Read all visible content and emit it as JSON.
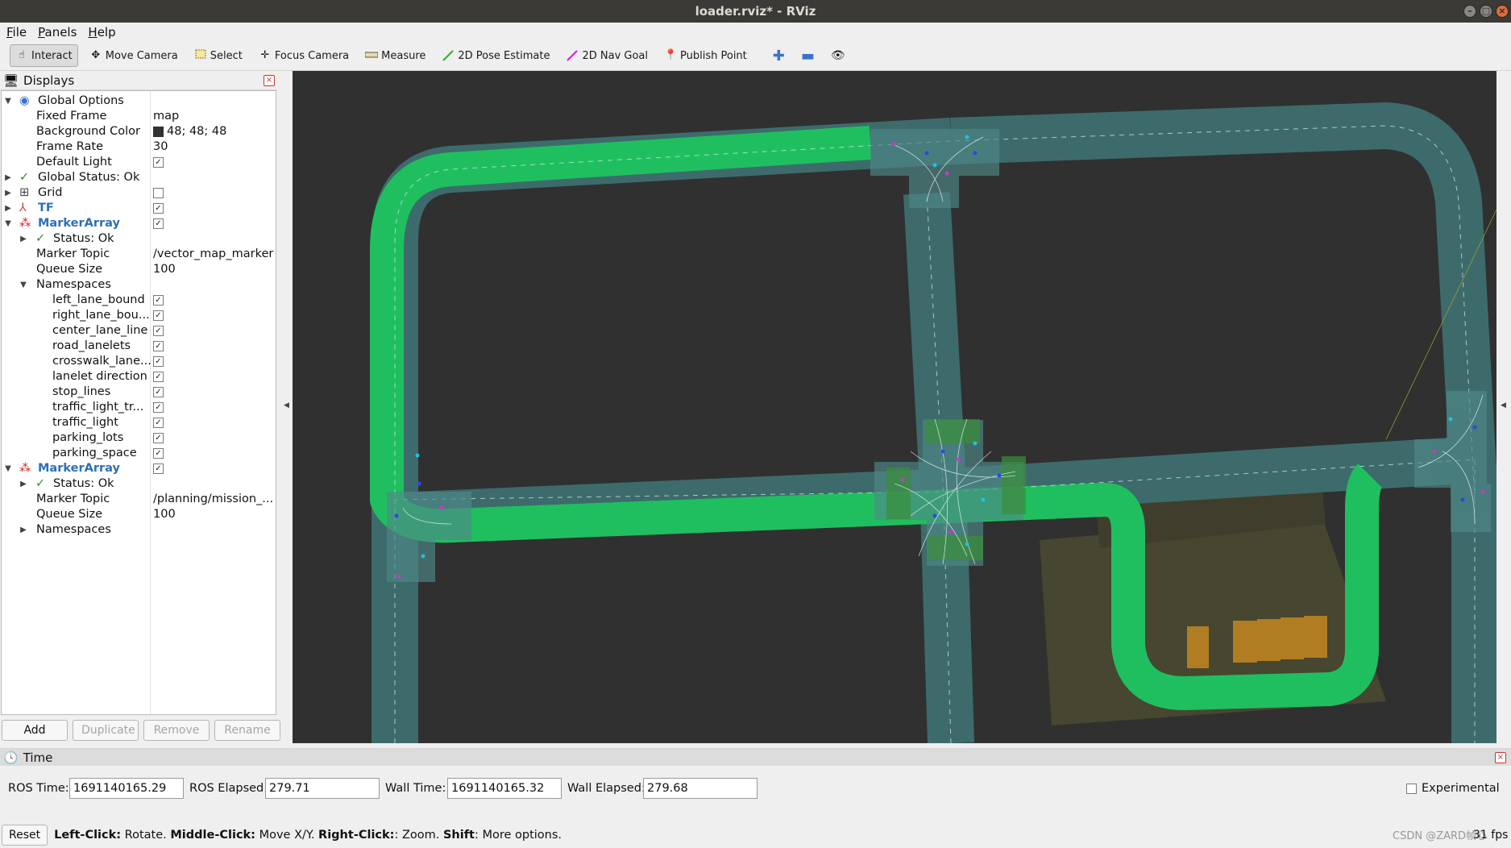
{
  "window": {
    "title": "loader.rviz* - RViz"
  },
  "menu": [
    "File",
    "Panels",
    "Help"
  ],
  "toolbar": {
    "tools": [
      {
        "label": "Interact",
        "icon": "hand-icon"
      },
      {
        "label": "Move Camera",
        "icon": "move-camera-icon"
      },
      {
        "label": "Select",
        "icon": "select-icon"
      },
      {
        "label": "Focus Camera",
        "icon": "focus-camera-icon"
      },
      {
        "label": "Measure",
        "icon": "ruler-icon"
      },
      {
        "label": "2D Pose Estimate",
        "icon": "green-arrow-icon"
      },
      {
        "label": "2D Nav Goal",
        "icon": "magenta-arrow-icon"
      },
      {
        "label": "Publish Point",
        "icon": "map-pin-icon"
      }
    ]
  },
  "displays": {
    "title": "Displays",
    "rows": [
      {
        "label": "Global Options",
        "value": ""
      },
      {
        "label": "Fixed Frame",
        "value": "map"
      },
      {
        "label": "Background Color",
        "value": "48; 48; 48"
      },
      {
        "label": "Frame Rate",
        "value": "30"
      },
      {
        "label": "Default Light",
        "value": ""
      },
      {
        "label": "Global Status: Ok",
        "value": ""
      },
      {
        "label": "Grid",
        "value": ""
      },
      {
        "label": "TF",
        "value": ""
      },
      {
        "label": "MarkerArray",
        "value": ""
      },
      {
        "label": "Status: Ok",
        "value": ""
      },
      {
        "label": "Marker Topic",
        "value": "/vector_map_marker"
      },
      {
        "label": "Queue Size",
        "value": "100"
      },
      {
        "label": "Namespaces",
        "value": ""
      },
      {
        "label": "left_lane_bound",
        "value": ""
      },
      {
        "label": "right_lane_bou...",
        "value": ""
      },
      {
        "label": "center_lane_line",
        "value": ""
      },
      {
        "label": "road_lanelets",
        "value": ""
      },
      {
        "label": "crosswalk_lane...",
        "value": ""
      },
      {
        "label": "lanelet direction",
        "value": ""
      },
      {
        "label": "stop_lines",
        "value": ""
      },
      {
        "label": "traffic_light_tr...",
        "value": ""
      },
      {
        "label": "traffic_light",
        "value": ""
      },
      {
        "label": "parking_lots",
        "value": ""
      },
      {
        "label": "parking_space",
        "value": ""
      },
      {
        "label": "MarkerArray",
        "value": ""
      },
      {
        "label": "Status: Ok",
        "value": ""
      },
      {
        "label": "Marker Topic",
        "value": "/planning/mission_..."
      },
      {
        "label": "Queue Size",
        "value": "100"
      },
      {
        "label": "Namespaces",
        "value": ""
      }
    ],
    "buttons": {
      "add": "Add",
      "duplicate": "Duplicate",
      "remove": "Remove",
      "rename": "Rename"
    }
  },
  "time": {
    "title": "Time",
    "ros_time_label": "ROS Time:",
    "ros_time": "1691140165.29",
    "ros_elapsed_label": "ROS Elapsed:",
    "ros_elapsed": "279.71",
    "wall_time_label": "Wall Time:",
    "wall_time": "1691140165.32",
    "wall_elapsed_label": "Wall Elapsed:",
    "wall_elapsed": "279.68",
    "experimental": "Experimental"
  },
  "status": {
    "reset": "Reset",
    "hint_b1": "Left-Click:",
    "hint_t1": " Rotate. ",
    "hint_b2": "Middle-Click:",
    "hint_t2": " Move X/Y. ",
    "hint_b3": "Right-Click:",
    "hint_t3": ": Zoom. ",
    "hint_b4": "Shift",
    "hint_t4": ": More options.",
    "fps": "31 fps",
    "watermark": "CSDN @ZARD帧心"
  },
  "colors": {
    "background": "#303030",
    "lane": "#3d6b6b",
    "route": "#1fbf5f",
    "parking": "#4a4a2e",
    "space": "#b07d22"
  }
}
